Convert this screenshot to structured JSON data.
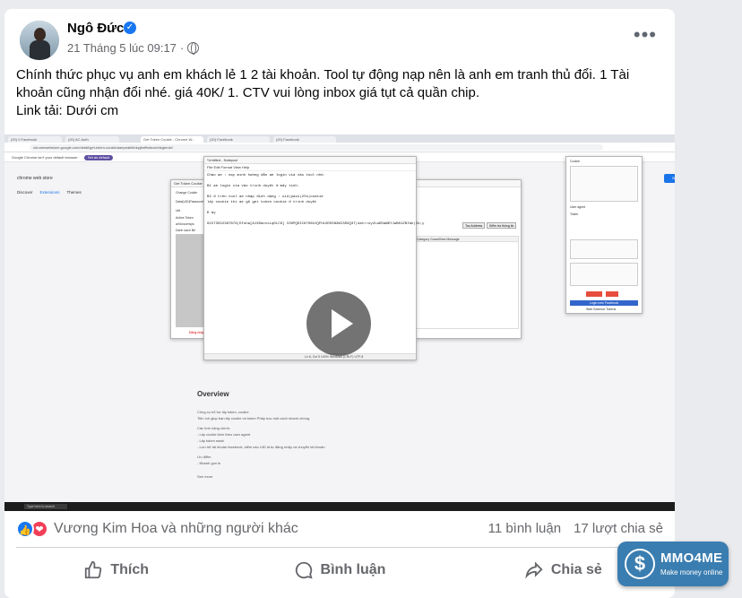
{
  "post": {
    "author": "Ngô Đức",
    "verified_mark": "✓",
    "timestamp": "21 Tháng 5 lúc 09:17",
    "separator": "·",
    "more_label": "•••",
    "text_lines": [
      "Chính thức phục vụ anh em khách lẻ 1 2 tài khoản. Tool tự động nạp nên là anh em tranh thủ đổi. 1 Tài",
      "khoản cũng nhận đổi nhé. giá 40K/ 1. CTV vui lòng inbox giá tụt cả quần chip.",
      "Link tải: Dưới cm"
    ]
  },
  "video": {
    "browser_tabs": [
      "(20) 0 Facebook",
      "(20) AC Auth",
      "Get Token Cookie - Chrome W...",
      "(20) Facebook",
      "(20) Facebook"
    ],
    "url": "chromewebstore.google.com/detail/get-token-cookie/aaepeabfkhkpjbeffbdeocbhkgbmlcf",
    "bookmark_bar": "Google Chrome isn't your default browser",
    "bookmark_button": "Set as default",
    "store_title": "chrome web store",
    "store_nav": [
      "Discover",
      "Extensions",
      "Themes"
    ],
    "notepad_title": "*Untitled - Notepad",
    "notepad_menu": "File   Edit   Format   View   Help",
    "notepad_content": "Chào ae : nay mình hướng dẫn ae login via vào tool nhé.\n\nB1 ae login via vào trình duyệt ở máy tính.\n\nB2 ở trên tool ae nhập định dạng : uid|pass|2fa|cookie\nlấy cookie thì ae gõ get token cookie ở trình duyệt\n\nĐ ảy\n\n61573552387876|Dfuha[AJXDacvsLqDLC8] COOPQDIC6706UJQFHLOD55N2WI3DUQ3T|datr=oy2LwDDaWKYJwB01ZNfak(Ik;y",
    "notepad_status": "Ln 6, Col 5     100%     Windows (CRLF)     UTF-8",
    "tool_title": "Get Token Cookie",
    "tool_labels": [
      "Change Cookie",
      "Data(UID|Password)",
      "Uid",
      "Active Token",
      "all lkxcomsys",
      "Danh sách Bé"
    ],
    "tool_buttons": [
      "Tao Address",
      "Kiểm tra thông tin"
    ],
    "tool_table_header": "Category     GuardView     Message",
    "tool_status": "Đăng nhập",
    "side_title": "Cookie",
    "side_token_label": "Token",
    "side_user_agent": "User agent",
    "side_login_btn": "Login new Facebook",
    "side_footer": "Wait Gearbox Tokens",
    "signin": "Sign in",
    "overview_title": "Overview",
    "overview_lines": [
      "Công cụ hỗ trợ lấy token, cookie",
      "Tiện ích giúp bạn lấy cookie và token Phây bọc một cách nhanh chóng.",
      "Các tính năng chính:",
      "- Lấy cookie kèm theo user agent",
      "- Lấy token eaab",
      "- Lưu trữ tài khoản facebook, kiểm vào UID là tự đăng nhập và chuyển tài khoản",
      "Ưu điểm",
      "- Nhanh gọn lẹ",
      "See more"
    ],
    "taskbar_search": "Type here to search"
  },
  "reactions": {
    "like_glyph": "👍",
    "love_glyph": "❤",
    "summary": "Vương Kim Hoa và những người khác",
    "comments": "11 bình luận",
    "shares": "17 lượt chia sẻ"
  },
  "actions": {
    "like": "Thích",
    "comment": "Bình luận",
    "share": "Chia sẻ"
  },
  "watermark": {
    "coin": "$",
    "brand": "MMO4ME",
    "tagline": "Make money online"
  },
  "colors": {
    "accent": "#1877f2",
    "love": "#f33e58",
    "muted": "#65676b",
    "badge": "#3a7db0"
  }
}
